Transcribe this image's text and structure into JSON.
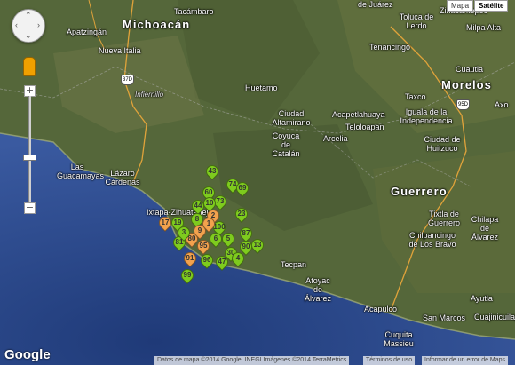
{
  "map_type": {
    "mapa": "Mapa",
    "satelite": "Satélite",
    "selected": "Satélite"
  },
  "colors": {
    "marker_green": "#7ecb1e",
    "marker_orange": "#f2a24d",
    "ocean": "#2b4b8c",
    "land": "#5c6e3c"
  },
  "labels": {
    "de_juarez": "de Juárez",
    "michoacan": "Michoacán",
    "tacambaro": "Tacámbaro",
    "apatzingan": "Apatzingán",
    "nueva_italia": "Nueva Italia",
    "infiernillo": "Infiernillo",
    "huetamo": "Huetamo",
    "toluca": "Toluca de Lerdo",
    "zinacantepec": "Zinacantepec",
    "milpa_alta": "Milpa Alta",
    "tenancingo": "Tenancingo",
    "cuautla": "Cuautla",
    "morelos": "Morelos",
    "taxco": "Taxco",
    "iguala": "Iguala de la Independencia",
    "ciudad_altamirano": "Ciudad Altamirano",
    "acapetlahuaya": "Acapetlahuaya",
    "teloloapan": "Teloloapan",
    "coyuca": "Coyuca de Catalán",
    "arcelia": "Arcelia",
    "huitzuco": "Ciudad de Huitzuco",
    "axo": "Axo",
    "las_guacamayas": "Las Guacamayas",
    "lazaro_cardenas": "Lázaro Cárdenas",
    "guerrero": "Guerrero",
    "ixtapa": "Ixtapa-Zihuatanejo",
    "tixtla": "Tixtla de Guerrero",
    "chilapa": "Chilapa de Álvarez",
    "chilpancingo": "Chilpancingo de Los Bravo",
    "tecpan": "Tecpan",
    "atoyac": "Atoyac de Álvarez",
    "acapulco": "Acapulco",
    "san_marcos": "San Marcos",
    "ayutla": "Ayutla",
    "cuajinicuilapa": "Cuajinicuilapa",
    "cuquita": "Cuquita Massieu"
  },
  "shields": {
    "r37d": "37D",
    "r95d": "95D"
  },
  "markers": [
    {
      "label": "43",
      "color": "green"
    },
    {
      "label": "74",
      "color": "green"
    },
    {
      "label": "69",
      "color": "green"
    },
    {
      "label": "60",
      "color": "green"
    },
    {
      "label": "73",
      "color": "green"
    },
    {
      "label": "10",
      "color": "green"
    },
    {
      "label": "44",
      "color": "green"
    },
    {
      "label": "23",
      "color": "green"
    },
    {
      "label": "17",
      "color": "orange"
    },
    {
      "label": "19",
      "color": "green"
    },
    {
      "label": "100",
      "color": "green"
    },
    {
      "label": "87",
      "color": "green"
    },
    {
      "label": "81",
      "color": "green"
    },
    {
      "label": "80",
      "color": "orange"
    },
    {
      "label": "95",
      "color": "orange"
    },
    {
      "label": "13",
      "color": "green"
    },
    {
      "label": "90",
      "color": "green"
    },
    {
      "label": "91",
      "color": "orange"
    },
    {
      "label": "96",
      "color": "green"
    },
    {
      "label": "47",
      "color": "green"
    },
    {
      "label": "99",
      "color": "green"
    },
    {
      "label": "8",
      "color": "green"
    },
    {
      "label": "2",
      "color": "orange"
    },
    {
      "label": "5",
      "color": "green"
    },
    {
      "label": "30",
      "color": "green"
    },
    {
      "label": "9",
      "color": "orange"
    },
    {
      "label": "6",
      "color": "green"
    },
    {
      "label": "3",
      "color": "green"
    },
    {
      "label": "4",
      "color": "green"
    },
    {
      "label": "1",
      "color": "orange"
    }
  ],
  "controls": {
    "zoom_in": "+",
    "zoom_out": "−"
  },
  "branding": {
    "logo": "Google"
  },
  "footer": {
    "data": "Datos de mapa ©2014 Google, INEGI Imágenes ©2014 TerraMetrics",
    "terms": "Términos de uso",
    "report": "Informar de un error de Maps"
  }
}
